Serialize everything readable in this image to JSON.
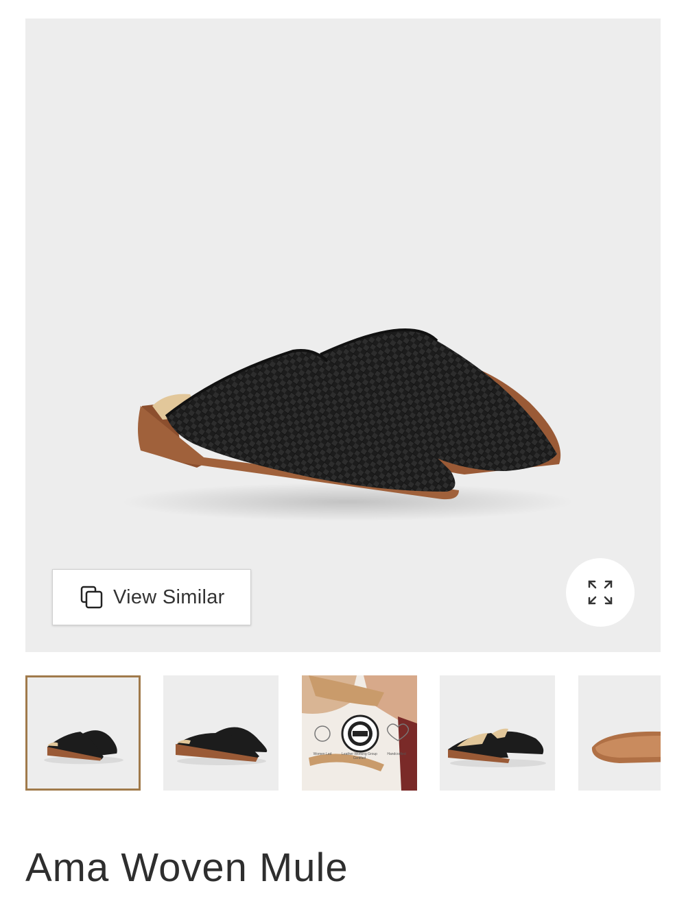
{
  "gallery": {
    "view_similar_label": "View Similar",
    "view_similar_icon": "copy-stack-icon",
    "expand_icon": "expand-arrows-icon",
    "background_color": "#ededed",
    "selected_thumbnail_border_color": "#a07a4b",
    "thumbnails": [
      {
        "subject": "pair-of-mules-front-angle",
        "selected": true
      },
      {
        "subject": "pair-of-mules-side-view",
        "selected": false
      },
      {
        "subject": "hands-weaving-leather-with-badges",
        "selected": false
      },
      {
        "subject": "mules-back-interior-view",
        "selected": false
      },
      {
        "subject": "mule-sole-view",
        "selected": false
      }
    ],
    "badges": {
      "left": "Women Led",
      "center": "Leather Working Group Certified",
      "right": "Handcrafted",
      "seal_top": "MEMBER",
      "seal_center": "LEATHER WORKING GROUP"
    }
  },
  "product": {
    "title": "Ama Woven Mule",
    "colors": {
      "leather": "#1c1c1c",
      "sole": "#9a5a36",
      "insole": "#e2c79a"
    }
  }
}
